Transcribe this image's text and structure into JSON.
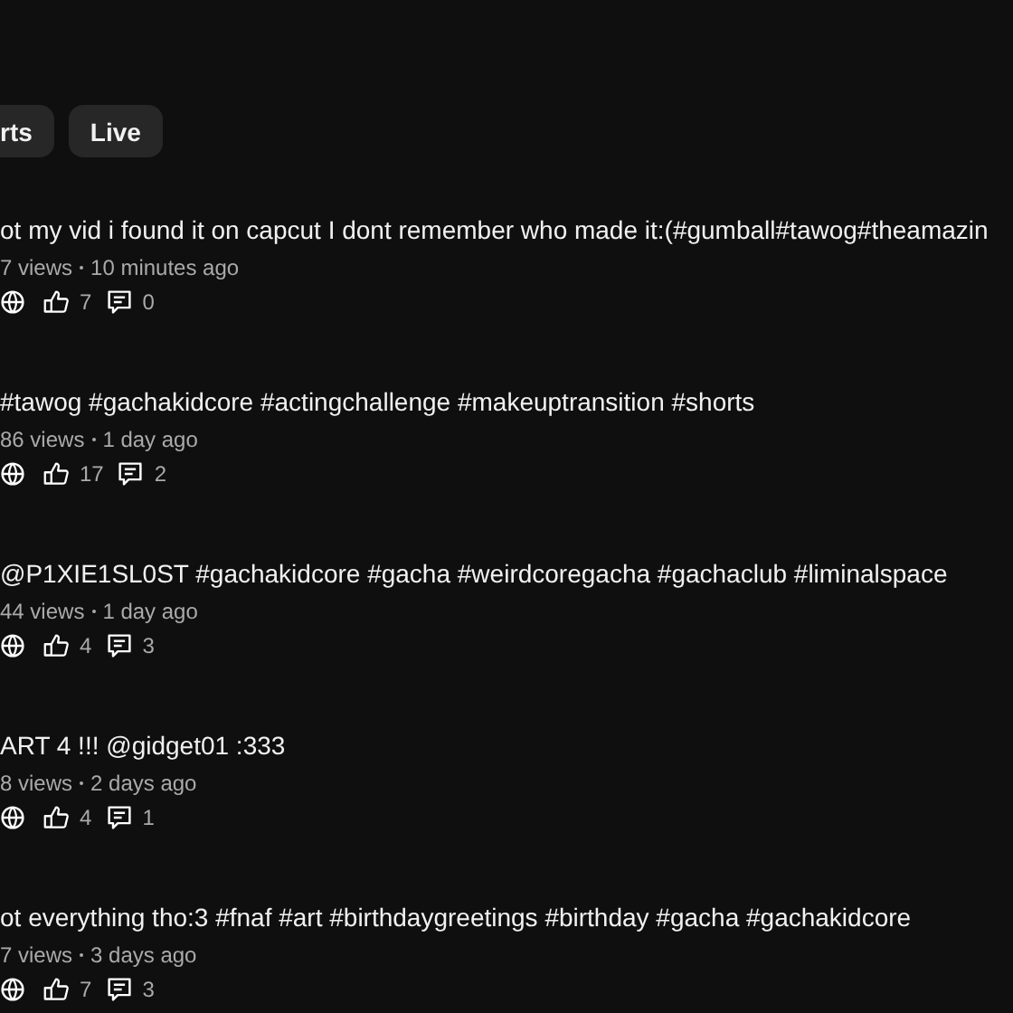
{
  "chips": [
    {
      "label": "rts",
      "selected": false
    },
    {
      "label": "Live",
      "selected": false
    }
  ],
  "videos": [
    {
      "title": "ot my vid i found it on capcut I dont remember who made it:(#gumball#tawog#theamazin",
      "views": "7 views",
      "age": "10 minutes ago",
      "likes": "7",
      "comments": "0"
    },
    {
      "title": "#tawog #gachakidcore #actingchallenge #makeuptransition #shorts",
      "views": "86 views",
      "age": "1 day ago",
      "likes": "17",
      "comments": "2"
    },
    {
      "title": "@P1XIE1SL0ST #gachakidcore #gacha #weirdcoregacha #gachaclub #liminalspace",
      "views": "44 views",
      "age": "1 day ago",
      "likes": "4",
      "comments": "3"
    },
    {
      "title": "ART 4 !!! @gidget01 :333",
      "views": "8 views",
      "age": "2 days ago",
      "likes": "4",
      "comments": "1"
    },
    {
      "title": "ot everything tho:3 #fnaf #art #birthdaygreetings #birthday #gacha #gachakidcore",
      "views": "7 views",
      "age": "3 days ago",
      "likes": "7",
      "comments": "3"
    }
  ]
}
